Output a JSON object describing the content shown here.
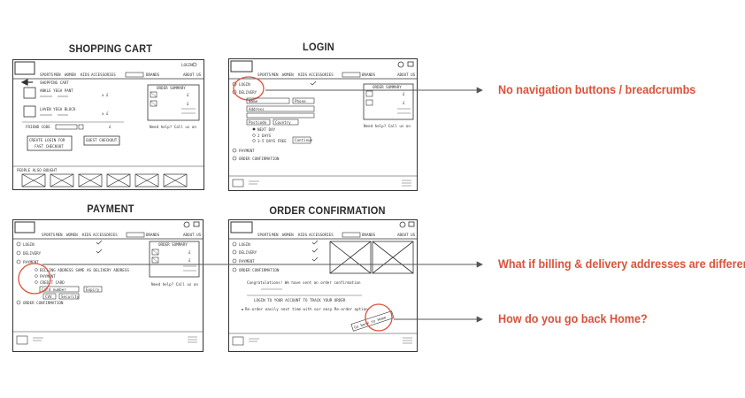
{
  "sections": {
    "cart": {
      "title": "SHOPPING CART"
    },
    "login": {
      "title": "LOGIN"
    },
    "payment": {
      "title": "PAYMENT"
    },
    "confirm": {
      "title": "ORDER CONFIRMATION"
    }
  },
  "nav": {
    "sports": "SPORTS",
    "men": "MEN",
    "women": "WOMEN",
    "kids": "KIDS",
    "accessories": "ACCESSORIES",
    "brands": "BRANDS",
    "about": "ABOUT US"
  },
  "cart": {
    "heading": "SHOPPING CART",
    "login_link": "LOGIN",
    "item1": "ANKLE YEGA PANT",
    "item2": "LAVEN YEGA BLOCK",
    "friend_code": "FRIEND CODE",
    "create_login": "CREATE  LOGIN  FOR",
    "fast_checkout": "FAST  CHECKOUT",
    "guest_checkout": "GUEST CHECKOUT",
    "order_summary": "ORDER SUMMARY",
    "help": "Need help? Call us on",
    "people_bought": "PEOPLE  ALSO  BOUGHT"
  },
  "login": {
    "step_login": "LOGIN",
    "step_delivery": "DELIVERY",
    "name_field": "Name",
    "phone_field": "Phone",
    "address_field": "Address",
    "postcode_field": "Postcode",
    "country_field": "Country",
    "next_day": "NEXT DAY",
    "two_days": "2 DAYS",
    "three_five_days": "3-5 DAYS FREE",
    "continue": "Continue",
    "payment": "PAYMENT",
    "order_confirmation": "ORDER CONFIRMATION",
    "order_summary": "ORDER SUMMARY",
    "help": "Need help? Call us on"
  },
  "payment": {
    "step_login": "LOGIN",
    "step_delivery": "DELIVERY",
    "step_payment": "PAYMENT",
    "billing_same": "BILLING ADDRESS SAME AS DELIVERY ADDRESS",
    "paypal": "PAYMENT",
    "credit_card": "CREDIT CARD",
    "card_number": "Card number",
    "expiry": "Expiry",
    "cvv": "CVV",
    "security": "Security",
    "order_confirmation": "ORDER CONFIRMATION",
    "order_summary": "ORDER SUMMARY",
    "help": "Need help? Call us on"
  },
  "confirm": {
    "step_login": "LOGIN",
    "step_delivery": "DELIVERY",
    "step_payment": "PAYMENT",
    "step_confirm": "ORDER CONFIRMATION",
    "congrats": "Congratulations! We have sent an order confirmation",
    "login_track": "LOGIN TO YOUR ACCOUNT TO TRACK YOUR ORDER",
    "reorder": "Re-order easily next time with our easy Re-order option",
    "back_home": "Go back to Home"
  },
  "annotations": {
    "a1": "No navigation buttons / breadcrumbs",
    "a2": "What if billing & delivery addresses are different?",
    "a3": "How do you go back Home?"
  },
  "colors": {
    "accent": "#d9533c",
    "ink": "#333333"
  }
}
